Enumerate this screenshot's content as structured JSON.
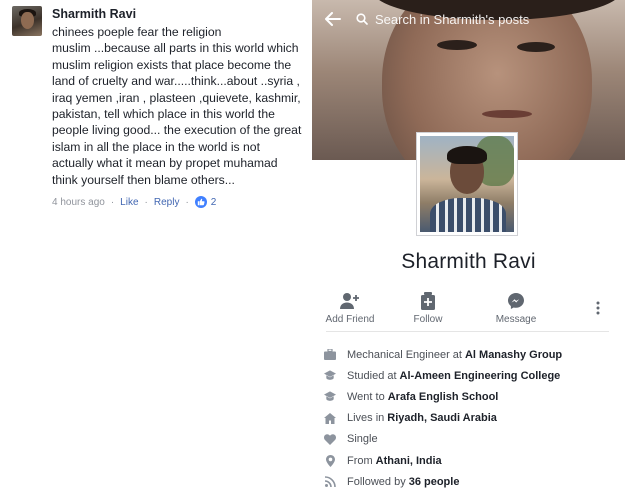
{
  "comment": {
    "author": "Sharmith Ravi",
    "text": "chinees poeple fear the religion\nmuslim ...because all parts in this world which\nmuslim religion exists that place become the\nland of cruelty and war.....think...about ..syria ,\niraq yemen ,iran , plasteen ,quievete, kashmir,\npakistan, tell which place in this world the\npeople living good... the execution of the great\nislam  in all the place in the world is not\nactually what it mean by propet muhamad\nthink yourself then blame others...",
    "time": "4 hours ago",
    "like_label": "Like",
    "reply_label": "Reply",
    "reaction_count": "2"
  },
  "profile": {
    "search_placeholder": "Search in Sharmith's posts",
    "name": "Sharmith Ravi",
    "actions": {
      "add_friend": "Add Friend",
      "follow": "Follow",
      "message": "Message"
    },
    "intro": [
      {
        "icon": "briefcase-icon",
        "prefix": "Mechanical Engineer at",
        "value": "Al Manashy Group"
      },
      {
        "icon": "graduation-cap-icon",
        "prefix": "Studied at",
        "value": "Al-Ameen Engineering College"
      },
      {
        "icon": "graduation-cap-icon",
        "prefix": "Went to",
        "value": "Arafa English School"
      },
      {
        "icon": "home-icon",
        "prefix": "Lives in",
        "value": "Riyadh, Saudi Arabia"
      },
      {
        "icon": "heart-icon",
        "prefix": "Single",
        "value": ""
      },
      {
        "icon": "location-pin-icon",
        "prefix": "From",
        "value": "Athani, India"
      },
      {
        "icon": "rss-icon",
        "prefix": "Followed by",
        "value": "36 people"
      }
    ]
  },
  "colors": {
    "link": "#4267b2",
    "text": "#1d2129",
    "muted": "#90949c",
    "icon": "#606770"
  }
}
